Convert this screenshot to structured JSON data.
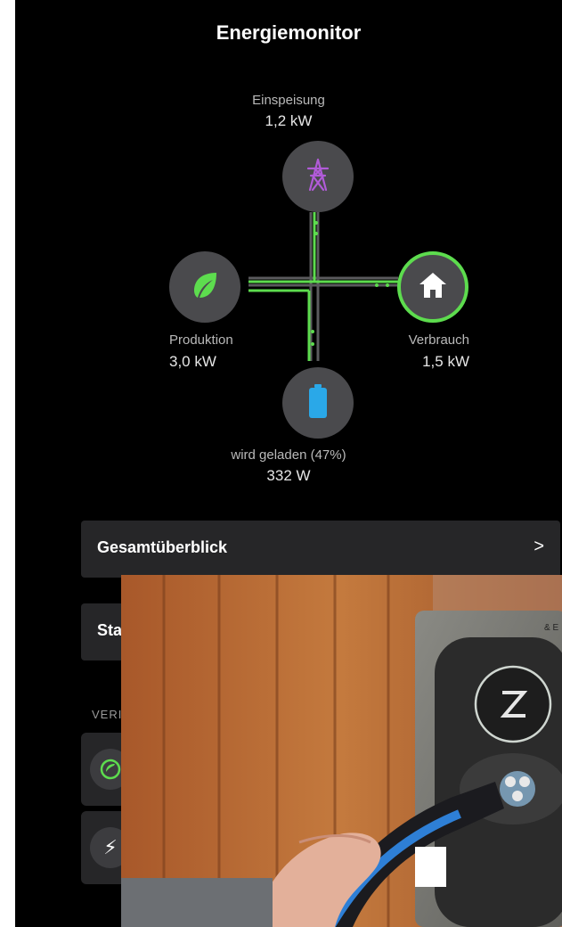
{
  "header": {
    "title": "Energiemonitor"
  },
  "nodes": {
    "grid": {
      "label": "Einspeisung",
      "value": "1,2 kW",
      "icon": "power-tower-icon",
      "color": "#b15bd8"
    },
    "production": {
      "label": "Produktion",
      "value": "3,0 kW",
      "icon": "leaf-icon",
      "color": "#5ddc4e"
    },
    "consumption": {
      "label": "Verbrauch",
      "value": "1,5 kW",
      "icon": "house-icon",
      "color": "#ffffff"
    },
    "battery": {
      "label": "wird geladen (47%)",
      "value": "332 W",
      "icon": "battery-icon",
      "color": "#2aa8e8",
      "level_percent": 47
    }
  },
  "cards": {
    "overview": {
      "label": "Gesamtüberblick",
      "chevron": ">"
    },
    "status": {
      "label": "Sta"
    }
  },
  "section": {
    "label": "VERI"
  },
  "small_cards": [
    {
      "icon": "leaf-circle-icon"
    },
    {
      "icon": "lightning-icon",
      "glyph": "⚡"
    }
  ],
  "colors": {
    "background": "#000000",
    "card": "#262628",
    "accent_green": "#5ddc4e",
    "node_gray": "#4a4a4d"
  }
}
